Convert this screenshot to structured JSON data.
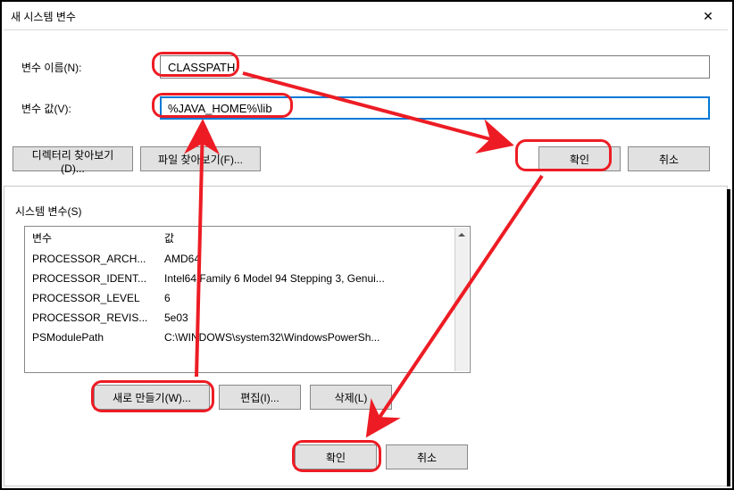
{
  "front_dialog": {
    "title": "새 시스템 변수",
    "name_label": "변수 이름(N):",
    "name_value": "CLASSPATH",
    "value_label": "변수 값(V):",
    "value_value": "%JAVA_HOME%\\lib",
    "browse_dir": "디렉터리 찾아보기(D)...",
    "browse_file": "파일 찾아보기(F)...",
    "ok": "확인",
    "cancel": "취소",
    "close": "✕"
  },
  "back_dialog": {
    "section_label": "시스템 변수(S)",
    "header_var": "변수",
    "header_val": "값",
    "rows": [
      {
        "name": "PROCESSOR_ARCH...",
        "value": "AMD64"
      },
      {
        "name": "PROCESSOR_IDENT...",
        "value": "Intel64 Family 6 Model 94 Stepping 3, Genui..."
      },
      {
        "name": "PROCESSOR_LEVEL",
        "value": "6"
      },
      {
        "name": "PROCESSOR_REVIS...",
        "value": "5e03"
      },
      {
        "name": "PSModulePath",
        "value": "C:\\WINDOWS\\system32\\WindowsPowerSh..."
      }
    ],
    "new_btn": "새로 만들기(W)...",
    "edit_btn": "편집(I)...",
    "delete_btn": "삭제(L)",
    "ok": "확인",
    "cancel": "취소"
  }
}
